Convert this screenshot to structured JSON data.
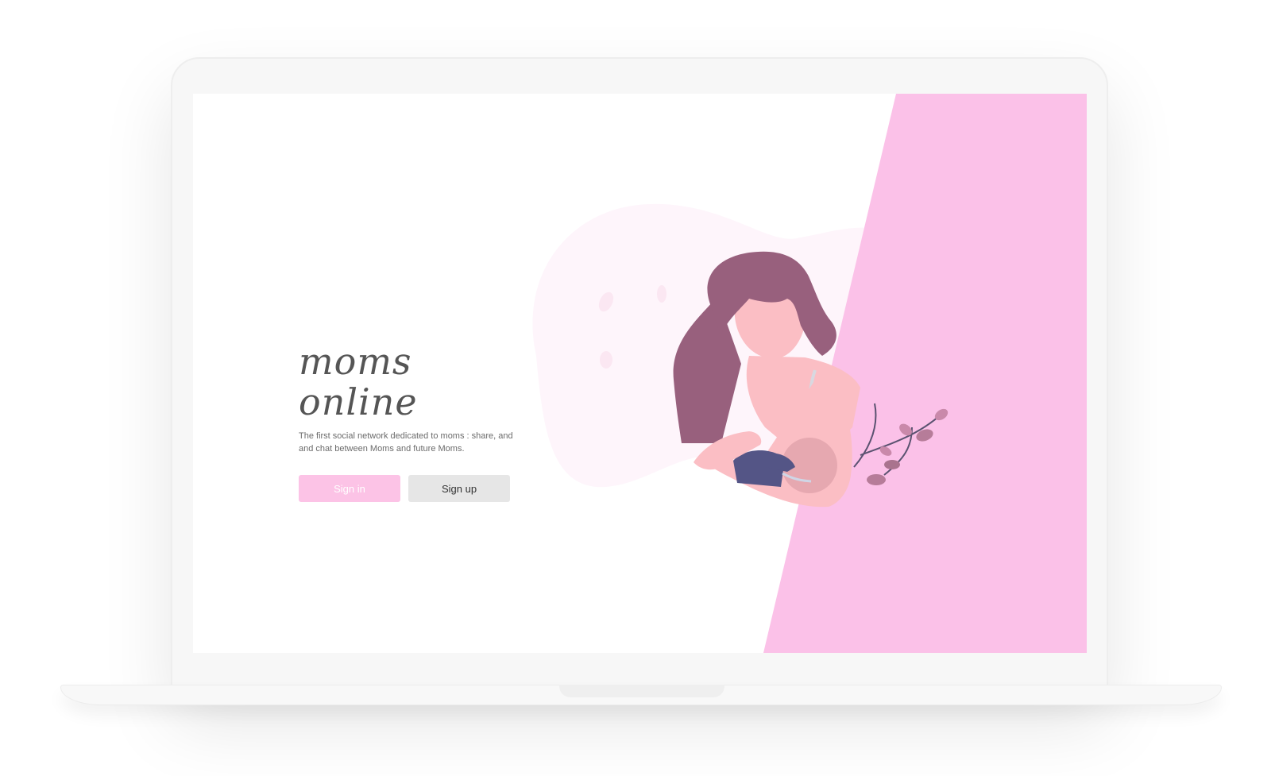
{
  "app": {
    "brand": "moms online",
    "tagline": "The first social network dedicated to moms : share, and and chat between Moms and future Moms."
  },
  "actions": {
    "signin_label": "Sign in",
    "signup_label": "Sign up"
  },
  "colors": {
    "accent_pink": "#fbc1e8",
    "signin_button": "#fcc3e6",
    "signup_button": "#e6e6e6",
    "hair": "#98607d",
    "skin": "#fbbec4",
    "baby_shirt": "#545586"
  },
  "icons": {
    "illustration": "mother-breastfeeding-illustration"
  }
}
